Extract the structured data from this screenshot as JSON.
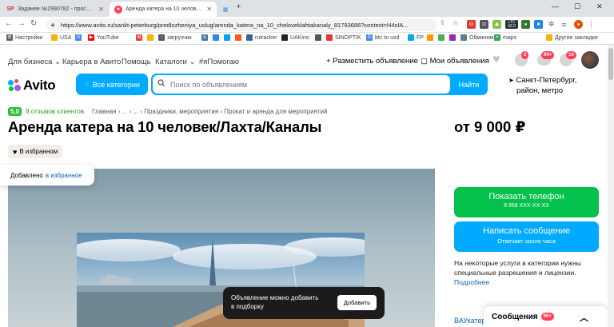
{
  "browser": {
    "tabs": [
      {
        "favicon": "SP",
        "favicon_color": "#d93025",
        "title": "Задание №2990782 - просмотр з...",
        "active": false
      },
      {
        "favicon": "●",
        "favicon_color": "#ff4053",
        "title": "Аренда катера на 10 человек/Ла...",
        "active": true
      },
      {
        "favicon": "▦",
        "favicon_color": "#4285f4",
        "title": "",
        "active": false
      }
    ],
    "url": "https://www.avito.ru/sankt-peterburg/predlozheniya_uslug/arenda_katera_na_10_cheloveklahtakanaly_81793686?context=H4sIA...",
    "ext_ltc_label": "LTC",
    "ext_ltc_value": "42.0",
    "ext_badge_value": "22",
    "bookmarks": [
      {
        "label": "Настройки",
        "icon": "gear-icon",
        "color": "#5f6368"
      },
      {
        "label": "USA",
        "icon": "folder-icon",
        "color": "#f4b400"
      },
      {
        "label": "",
        "icon": "google-icon",
        "color": "#4285f4"
      },
      {
        "label": "YouTube",
        "icon": "youtube-icon",
        "color": "#ff0000"
      },
      {
        "label": "",
        "icon": "gmail-icon",
        "color": "#ea4335"
      },
      {
        "label": "",
        "icon": "folder-icon",
        "color": "#f4b400"
      },
      {
        "label": "загрузчик",
        "icon": "download-icon",
        "color": "#555"
      },
      {
        "label": "",
        "icon": "vk-icon",
        "color": "#4a76a8"
      },
      {
        "label": "",
        "icon": "site-icon",
        "color": "#2d89ef"
      },
      {
        "label": "",
        "icon": "site-icon",
        "color": "#00a4ef"
      },
      {
        "label": "",
        "icon": "site-icon",
        "color": "#ff5722"
      },
      {
        "label": "rutracker",
        "icon": "site-icon",
        "color": "#336699"
      },
      {
        "label": "UAKino",
        "icon": "site-icon",
        "color": "#222"
      },
      {
        "label": "",
        "icon": "site-icon",
        "color": "#555"
      },
      {
        "label": "SINOPTIK",
        "icon": "site-icon",
        "color": "#e53935"
      },
      {
        "label": "btc to usd",
        "icon": "google-icon",
        "color": "#4285f4"
      },
      {
        "label": "FP",
        "icon": "site-icon",
        "color": "#03a9f4"
      },
      {
        "label": "",
        "icon": "site-icon",
        "color": "#ff9800"
      },
      {
        "label": "",
        "icon": "site-icon",
        "color": "#4caf50"
      },
      {
        "label": "",
        "icon": "site-icon",
        "color": "#9c27b0"
      },
      {
        "label": "Обмінник",
        "icon": "site-icon",
        "color": "#607d8b"
      },
      {
        "label": "maps",
        "icon": "maps-icon",
        "color": "#34a853"
      },
      {
        "label": "Другие закладки",
        "icon": "folder-icon",
        "color": "#f4b400"
      }
    ]
  },
  "topnav": {
    "for_business": "Для бизнеса",
    "career": "Карьера в Авито",
    "help": "Помощь",
    "catalogs": "Каталоги",
    "help_tag": "#яПомогаю",
    "post_ad": "+ Разместить объявление",
    "my_ads": "Мои объявления",
    "badge_notifications": "2",
    "badge_messages": "99+",
    "badge_cart": "16"
  },
  "header": {
    "logo": "Avito",
    "all_categories": "Все категории",
    "search_placeholder": "Поиск по объявлениям",
    "search_button": "Найти",
    "location_line1": "Санкт-Петербург,",
    "location_line2": "район, метро"
  },
  "listing": {
    "rating": "5,0",
    "reviews": "8 отзывов клиентов",
    "breadcrumbs": [
      "Главная",
      "...",
      "...",
      "Праздники, мероприятия",
      "Прокат и аренда для мероприятий"
    ],
    "title": "Аренда катера на 10 человек/Лахта/Каналы",
    "price": "от 9 000 ₽",
    "favorite_button": "В избранном",
    "fav_toast_text": "Добавлено",
    "fav_toast_link": "в избранное",
    "show_phone": "Показать телефон",
    "phone_masked": "8 958 XXX-XX-XX",
    "write_message": "Написать сообщение",
    "reply_time": "Отвечает около часа",
    "notice": "На некоторые услуги в категории нужны специальные разрешения и лицензии.",
    "notice_more": "Подробнее",
    "seller_link": "ВАУкатер",
    "add_toast_line1": "Объявление можно добавить",
    "add_toast_line2": "в подборку",
    "add_toast_button": "Добавить"
  },
  "chat": {
    "label": "Сообщения",
    "badge": "99+"
  },
  "colors": {
    "accent": "#00aaff",
    "phone_green": "#04c04c",
    "badge_red": "#ff4053",
    "link": "#0a64bc"
  }
}
